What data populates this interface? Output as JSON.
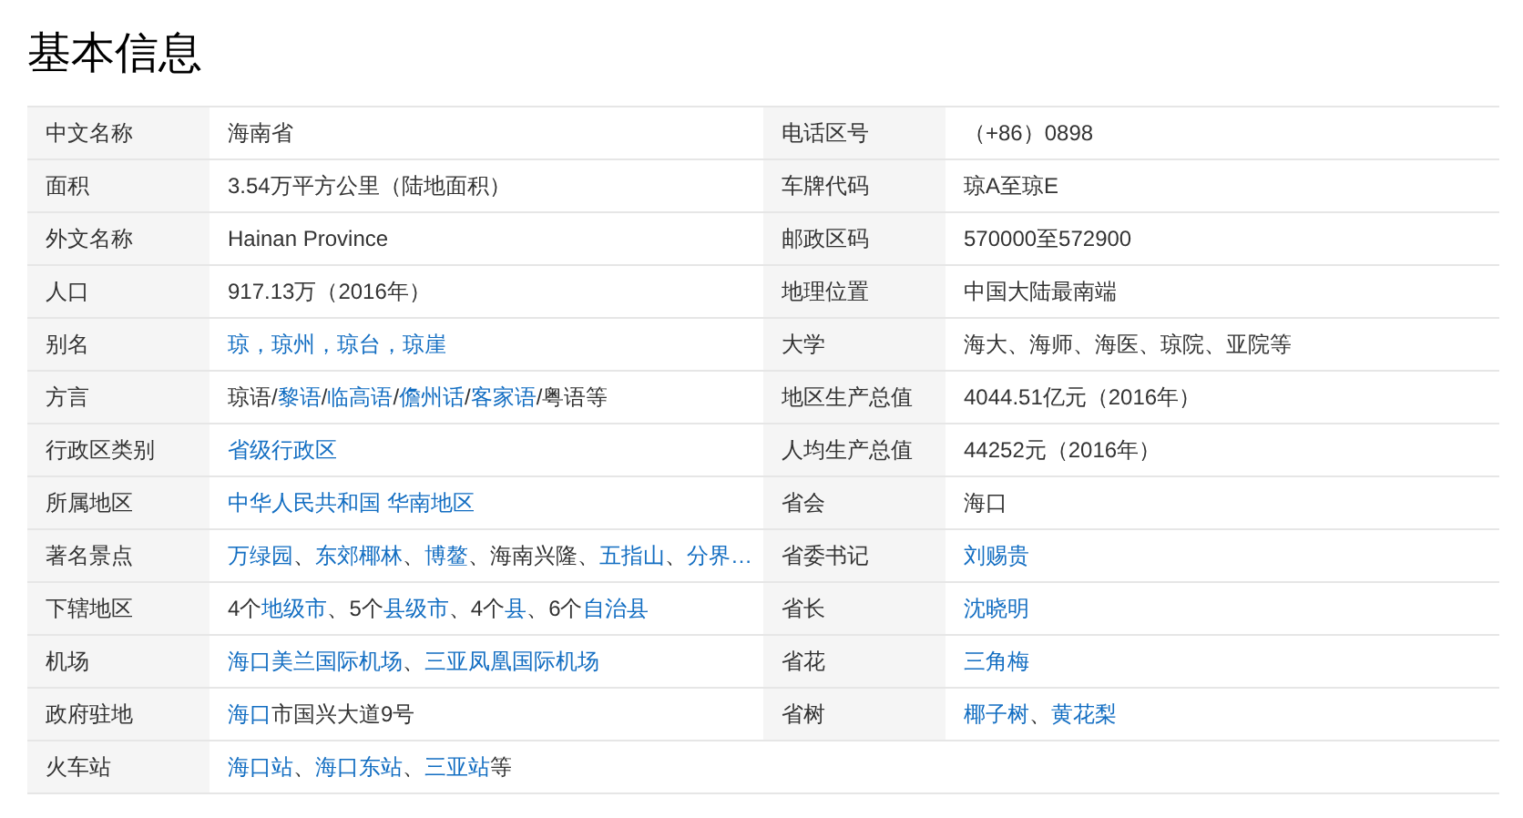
{
  "title": "基本信息",
  "rows": [
    {
      "left": {
        "label": "中文名称",
        "value": [
          {
            "text": "海南省",
            "link": false
          }
        ]
      },
      "right": {
        "label": "电话区号",
        "value": [
          {
            "text": "（+86）0898",
            "link": false
          }
        ]
      }
    },
    {
      "left": {
        "label": "面积",
        "value": [
          {
            "text": "3.54万平方公里（陆地面积）",
            "link": false
          }
        ]
      },
      "right": {
        "label": "车牌代码",
        "value": [
          {
            "text": "琼A至琼E",
            "link": false
          }
        ]
      }
    },
    {
      "left": {
        "label": "外文名称",
        "value": [
          {
            "text": "Hainan Province",
            "link": false
          }
        ]
      },
      "right": {
        "label": "邮政区码",
        "value": [
          {
            "text": "570000至572900",
            "link": false
          }
        ]
      }
    },
    {
      "left": {
        "label": "人口",
        "value": [
          {
            "text": "917.13万（2016年）",
            "link": false
          }
        ]
      },
      "right": {
        "label": "地理位置",
        "value": [
          {
            "text": "中国大陆最南端",
            "link": false
          }
        ]
      }
    },
    {
      "left": {
        "label": "别名",
        "value": [
          {
            "text": "琼，琼州，琼台，琼崖",
            "link": true
          }
        ]
      },
      "right": {
        "label": "大学",
        "value": [
          {
            "text": "海大、海师、海医、琼院、亚院等",
            "link": false
          }
        ]
      }
    },
    {
      "left": {
        "label": "方言",
        "value": [
          {
            "text": "琼语/",
            "link": false
          },
          {
            "text": "黎语",
            "link": true
          },
          {
            "text": "/",
            "link": false
          },
          {
            "text": "临高语",
            "link": true
          },
          {
            "text": "/",
            "link": false
          },
          {
            "text": "儋州话",
            "link": true
          },
          {
            "text": "/",
            "link": false
          },
          {
            "text": "客家语",
            "link": true
          },
          {
            "text": "/粤语等",
            "link": false
          }
        ]
      },
      "right": {
        "label": "地区生产总值",
        "value": [
          {
            "text": "4044.51亿元（2016年）",
            "link": false
          }
        ]
      }
    },
    {
      "left": {
        "label": "行政区类别",
        "value": [
          {
            "text": "省级行政区",
            "link": true
          }
        ]
      },
      "right": {
        "label": "人均生产总值",
        "value": [
          {
            "text": "44252元（2016年）",
            "link": false
          }
        ]
      }
    },
    {
      "left": {
        "label": "所属地区",
        "value": [
          {
            "text": "中华人民共和国",
            "link": true
          },
          {
            "text": "华南地区",
            "link": true,
            "spaced": true
          }
        ]
      },
      "right": {
        "label": "省会",
        "value": [
          {
            "text": "海口",
            "link": false
          }
        ]
      }
    },
    {
      "left": {
        "label": "著名景点",
        "value": [
          {
            "text": "万绿园",
            "link": true
          },
          {
            "text": "、",
            "link": false
          },
          {
            "text": "东郊椰林",
            "link": true
          },
          {
            "text": "、",
            "link": false
          },
          {
            "text": "博鳌",
            "link": true
          },
          {
            "text": "、海南兴隆、",
            "link": false
          },
          {
            "text": "五指山",
            "link": true
          },
          {
            "text": "、",
            "link": false
          },
          {
            "text": "分界…",
            "link": true
          }
        ]
      },
      "right": {
        "label": "省委书记",
        "value": [
          {
            "text": "刘赐贵",
            "link": true
          }
        ]
      }
    },
    {
      "left": {
        "label": "下辖地区",
        "value": [
          {
            "text": "4个",
            "link": false
          },
          {
            "text": "地级市",
            "link": true
          },
          {
            "text": "、5个",
            "link": false
          },
          {
            "text": "县级市",
            "link": true
          },
          {
            "text": "、4个",
            "link": false
          },
          {
            "text": "县",
            "link": true
          },
          {
            "text": "、6个",
            "link": false
          },
          {
            "text": "自治县",
            "link": true
          }
        ]
      },
      "right": {
        "label": "省长",
        "value": [
          {
            "text": "沈晓明",
            "link": true
          }
        ]
      }
    },
    {
      "left": {
        "label": "机场",
        "value": [
          {
            "text": "海口美兰国际机场",
            "link": true
          },
          {
            "text": "、",
            "link": false
          },
          {
            "text": "三亚凤凰国际机场",
            "link": true
          }
        ]
      },
      "right": {
        "label": "省花",
        "value": [
          {
            "text": "三角梅",
            "link": true
          }
        ]
      }
    },
    {
      "left": {
        "label": "政府驻地",
        "value": [
          {
            "text": "海口",
            "link": true
          },
          {
            "text": "市国兴大道9号",
            "link": false
          }
        ]
      },
      "right": {
        "label": "省树",
        "value": [
          {
            "text": "椰子树",
            "link": true
          },
          {
            "text": "、",
            "link": false
          },
          {
            "text": "黄花梨",
            "link": true
          }
        ]
      }
    },
    {
      "left": {
        "label": "火车站",
        "value": [
          {
            "text": "海口站",
            "link": true
          },
          {
            "text": "、",
            "link": false
          },
          {
            "text": "海口东站",
            "link": true
          },
          {
            "text": "、",
            "link": false
          },
          {
            "text": "三亚站",
            "link": true
          },
          {
            "text": "等",
            "link": false
          }
        ]
      }
    }
  ]
}
